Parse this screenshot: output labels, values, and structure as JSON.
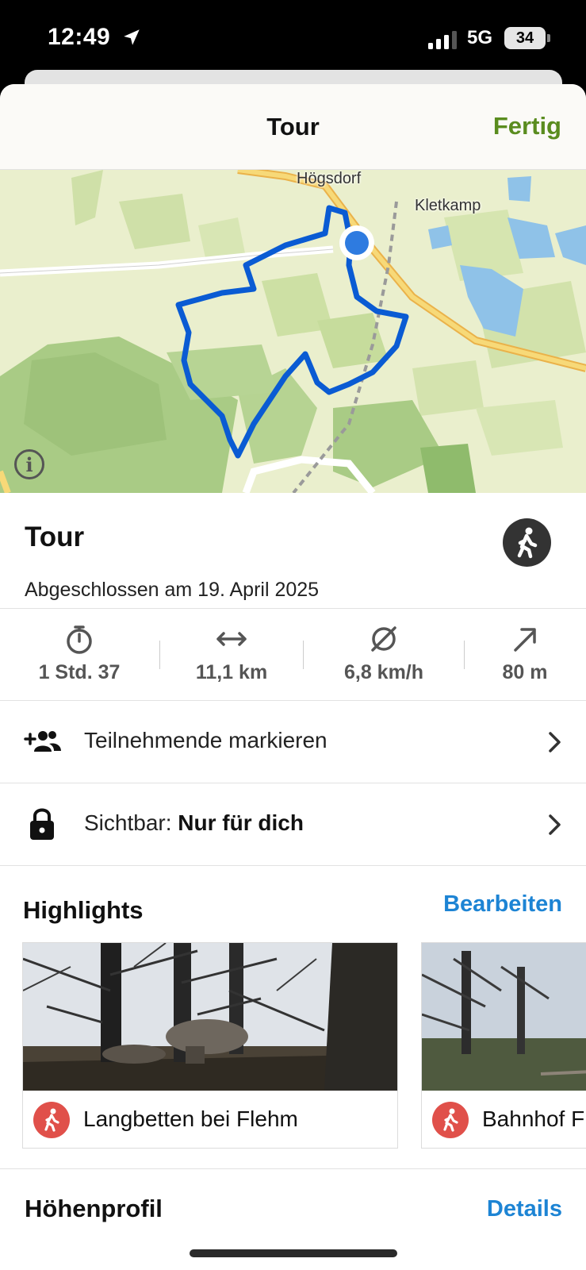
{
  "status_bar": {
    "time": "12:49",
    "network": "5G",
    "battery": "34"
  },
  "nav": {
    "title": "Tour",
    "done_label": "Fertig"
  },
  "map": {
    "labels": {
      "village_1": "Högsdorf",
      "village_2": "Kletkamp"
    },
    "info_label": "i",
    "route_color": "#0a5bd3",
    "position_color": "#2e7be0"
  },
  "tour": {
    "title": "Tour",
    "completed": "Abgeschlossen am 19. April 2025",
    "sport_icon": "hiking-icon"
  },
  "stats": [
    {
      "icon": "stopwatch-icon",
      "value": "1 Std. 37"
    },
    {
      "icon": "distance-icon",
      "value": "11,1 km"
    },
    {
      "icon": "average-speed-icon",
      "value": "6,8 km/h"
    },
    {
      "icon": "elevation-up-icon",
      "value": "80 m"
    }
  ],
  "rows": {
    "participants": {
      "label": "Teilnehmende markieren"
    },
    "visibility": {
      "prefix": "Sichtbar: ",
      "value": "Nur für dich"
    }
  },
  "highlights": {
    "title": "Highlights",
    "edit_label": "Bearbeiten",
    "items": [
      {
        "name": "Langbetten bei Flehm"
      },
      {
        "name": "Bahnhof F"
      }
    ]
  },
  "elevation": {
    "title": "Höhenprofil",
    "details_label": "Details"
  },
  "colors": {
    "accent_green": "#5a8c1f",
    "link_blue": "#1d84d4",
    "highlight_red": "#e0504a"
  }
}
